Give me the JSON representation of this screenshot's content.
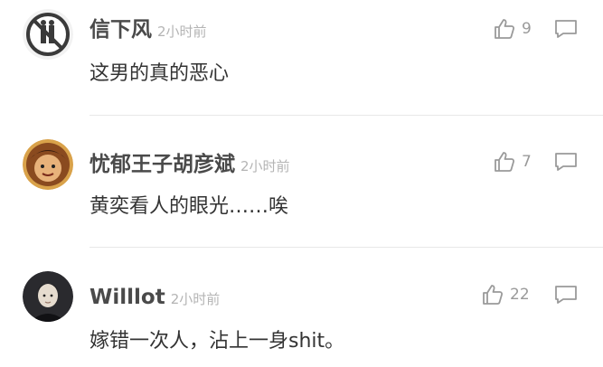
{
  "comments": [
    {
      "username": "信下风",
      "time": "2小时前",
      "text": "这男的真的恶心",
      "likes": "9",
      "avatar_icon": "no-entry-sign-icon"
    },
    {
      "username": "忧郁王子胡彦斌",
      "time": "2小时前",
      "text": "黄奕看人的眼光……唉",
      "likes": "7",
      "avatar_icon": "cartoon-face-avatar"
    },
    {
      "username": "Willlot",
      "time": "2小时前",
      "text": "嫁错一次人，沾上一身shit。",
      "likes": "22",
      "avatar_icon": "photo-avatar"
    }
  ],
  "colors": {
    "name": "#4a4a4a",
    "time": "#b4b4b4",
    "text": "#333333",
    "icon": "#9a9a9a",
    "divider": "#e8e8e8"
  }
}
